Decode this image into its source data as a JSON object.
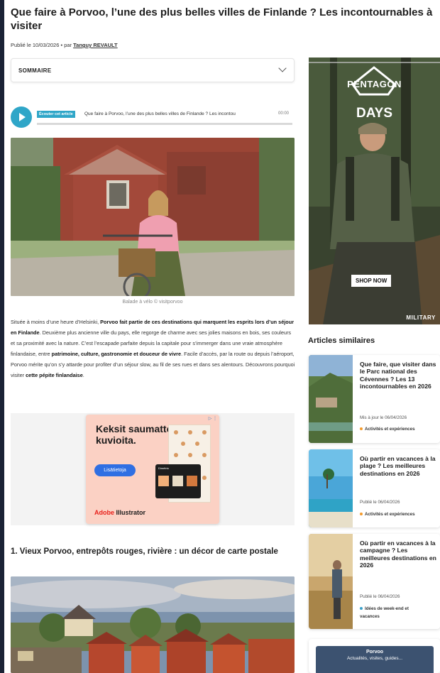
{
  "article": {
    "title": "Que faire à Porvoo, l’une des plus belles villes de Finlande ? Les incontournables à visiter",
    "published": "Publié le 10/03/2026",
    "by": "par",
    "author": "Tanguy REVAULT"
  },
  "sommaire": {
    "label": "SOMMAIRE"
  },
  "player": {
    "tag": "Écouter cet article",
    "title": "Que faire à Porvoo, l’une des plus belles villes de Finlande ? Les incontou",
    "time": "00:00"
  },
  "photo1": {
    "caption": "Balade à vélo © visitporvoo"
  },
  "intro": {
    "p1": "Située à moins d’une heure d’Helsinki, ",
    "b1": "Porvoo fait partie de ces destinations qui marquent les esprits lors d’un séjour en Finlande",
    "p2": ". Deuxième plus ancienne ville du pays, elle regorge de charme avec ses jolies maisons en bois, ses couleurs et sa proximité avec la nature. C’est l’escapade parfaite depuis la capitale pour s’immerger dans une vraie atmosphère finlandaise, entre ",
    "b2": "patrimoine, culture, gastronomie et douceur de vivre",
    "p3": ". Facile d’accès, par la route ou depuis l’aéroport, Porvoo mérite qu’on s’y attarde pour profiter d’un séjour slow, au fil de ses rues et dans ses alentours. Découvrons pourquoi visiter ",
    "b3": "cette pépite finlandaise",
    "p4": "."
  },
  "ad_adobe": {
    "headline": "Keksit saumattomia kuvioita.",
    "button": "Lisätietoja",
    "brand_a": "Adobe",
    "brand_b": " Illustrator",
    "phone_label": "Dimétrio"
  },
  "section1": {
    "heading": "1. Vieux Porvoo, entrepôts rouges, rivière : un décor de carte postale"
  },
  "ad_pentagon": {
    "brand": "PENTAGON",
    "days": "DAYS",
    "cta": "SHOP NOW",
    "tag": "MILITARY"
  },
  "similar": {
    "heading": "Articles similaires",
    "items": [
      {
        "title": "Que faire, que visiter dans le Parc national des Cévennes ? Les 13 incontournables en 2026",
        "date": "Mis à jour le 06/04/2026",
        "category": "Activités et expériences"
      },
      {
        "title": "Où partir en vacances à la plage ? Les meilleures destinations en 2026",
        "date": "Publié le 06/04/2026",
        "category": "Activités et expériences"
      },
      {
        "title": "Où partir en vacances à la campagne ? Les meilleures destinations en 2026",
        "date": "Publié le 06/04/2026",
        "category": "Idées de week-end et vacances"
      }
    ]
  },
  "porvoo_box": {
    "name": "Porvoo",
    "subtitle": "Actualités, visites, guides..."
  }
}
